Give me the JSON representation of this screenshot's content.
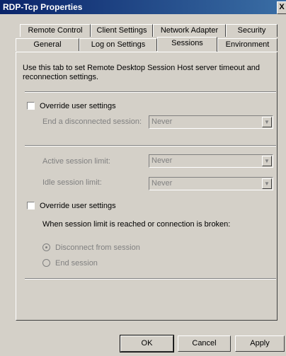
{
  "window": {
    "title": "RDP-Tcp Properties",
    "close_glyph": "X"
  },
  "tabs_row1": [
    "Remote Control",
    "Client Settings",
    "Network Adapter",
    "Security"
  ],
  "tabs_row2": [
    "General",
    "Log on Settings",
    "Sessions",
    "Environment"
  ],
  "active_tab": "Sessions",
  "sessions": {
    "description": "Use this tab to set Remote Desktop Session Host server timeout and reconnection settings.",
    "override1_label": "Override user settings",
    "end_disconnected_label": "End a disconnected session:",
    "end_disconnected_value": "Never",
    "active_limit_label": "Active session limit:",
    "active_limit_value": "Never",
    "idle_limit_label": "Idle session limit:",
    "idle_limit_value": "Never",
    "override2_label": "Override user settings",
    "when_limit_label": "When session limit is reached or connection is broken:",
    "radio_disconnect": "Disconnect from session",
    "radio_end": "End session"
  },
  "buttons": {
    "ok": "OK",
    "cancel": "Cancel",
    "apply": "Apply"
  }
}
